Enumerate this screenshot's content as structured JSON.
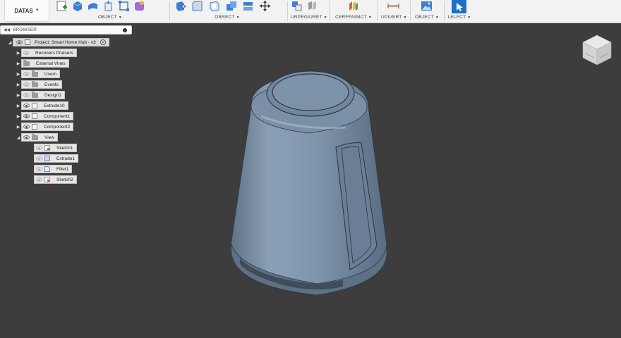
{
  "toolbar": {
    "workspace": "DATAS",
    "groups": [
      {
        "label": "OBJECT"
      },
      {
        "label": "OBRECT"
      },
      {
        "label": "URPEGIURET"
      },
      {
        "label": "CERFENIMCT"
      },
      {
        "label": "UPIVERT"
      },
      {
        "label": "OBJECT"
      },
      {
        "label": "LELECT"
      }
    ]
  },
  "browser": {
    "title": "BROWSER",
    "root": "Project: Smart Home Hub - v3",
    "items": [
      {
        "label": "Reconers Pratsers"
      },
      {
        "label": "External Vines"
      },
      {
        "label": "Usem"
      },
      {
        "label": "Events"
      },
      {
        "label": "Design1"
      },
      {
        "label": "Extrude10"
      },
      {
        "label": "Component1"
      },
      {
        "label": "Component2"
      },
      {
        "label": "View"
      }
    ],
    "children": [
      {
        "label": "Sketch1"
      },
      {
        "label": "Extrude1"
      },
      {
        "label": "Fillet1"
      },
      {
        "label": "Sketch2"
      }
    ]
  },
  "colors": {
    "viewport": "#3d3d3d",
    "model_body": "#7d93aa",
    "accent_blue": "#2d7fd3"
  }
}
